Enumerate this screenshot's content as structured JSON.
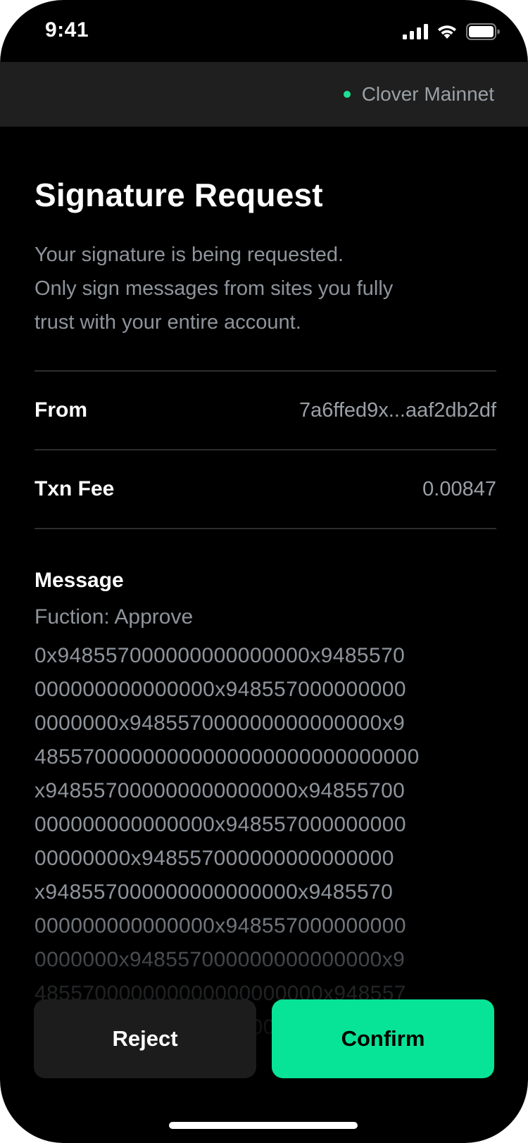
{
  "status_bar": {
    "time": "9:41"
  },
  "network": {
    "name": "Clover Mainnet",
    "dot_color": "#1ee192"
  },
  "header": {
    "title": "Signature Request",
    "description_lines": [
      "Your signature is being requested.",
      "Only sign messages from sites you fully",
      "trust with your entire account."
    ]
  },
  "details": {
    "from_label": "From",
    "from_value": "7a6ffed9x...aaf2db2df",
    "fee_label": "Txn Fee",
    "fee_value": "0.00847"
  },
  "message": {
    "label": "Message",
    "function_line": "Fuction: Approve",
    "lines": [
      "0x948557000000000000000x9485570",
      "000000000000000x948557000000000",
      "0000000x948557000000000000000x9",
      "48557000000000000000000000000000",
      "x948557000000000000000x94855700",
      "000000000000000x948557000000000",
      "00000000x948557000000000000000",
      "x948557000000000000000x9485570",
      "000000000000000x948557000000000",
      "0000000x948557000000000000000x9",
      "485570000000000000000000x948557",
      "00000000000000000000000000000000"
    ]
  },
  "actions": {
    "reject_label": "Reject",
    "confirm_label": "Confirm",
    "confirm_color": "#07e497"
  }
}
